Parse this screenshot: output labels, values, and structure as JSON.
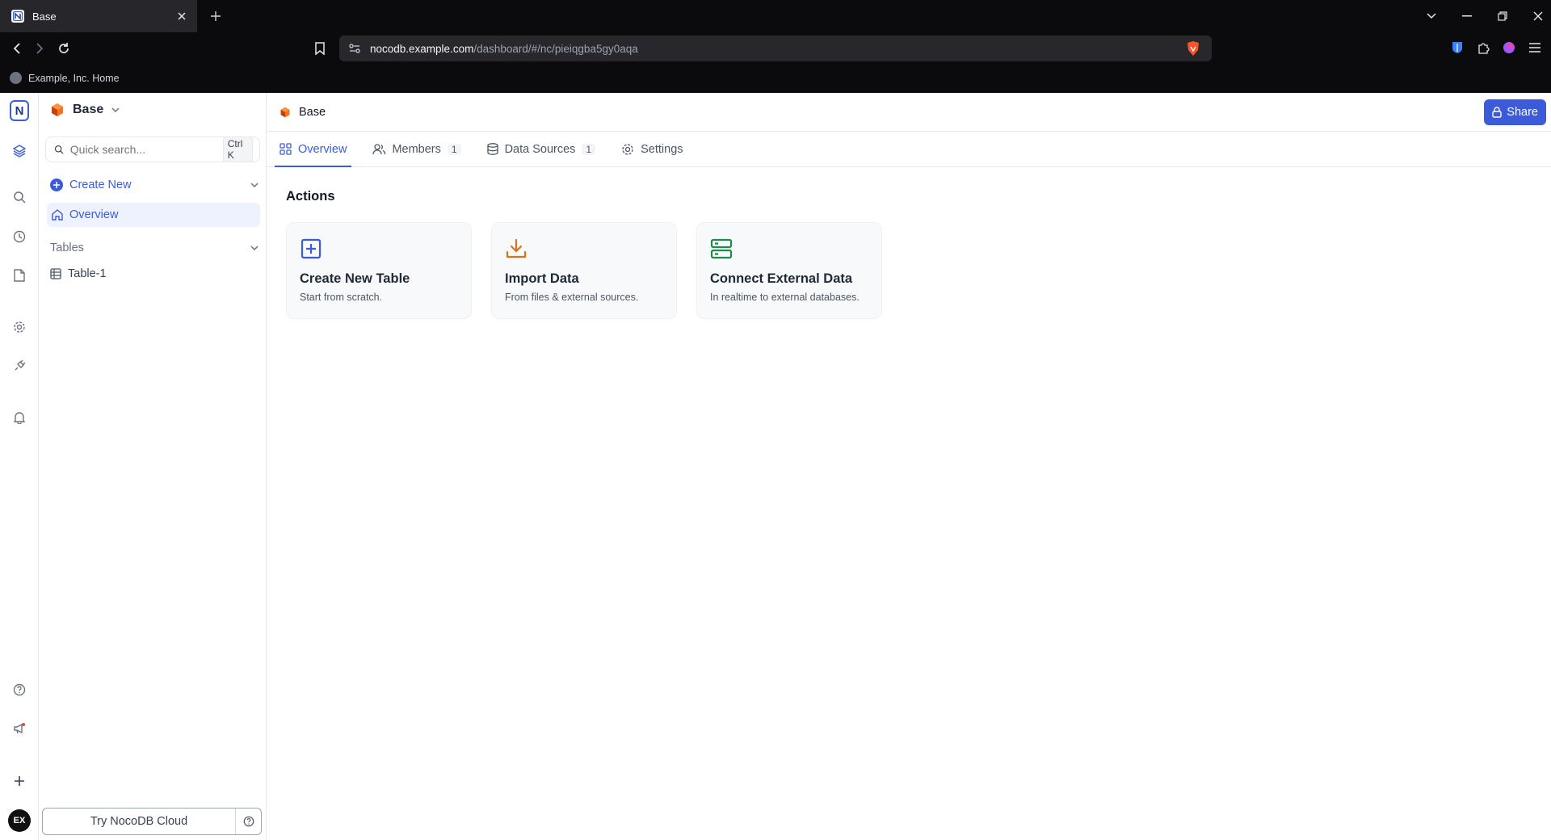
{
  "browser": {
    "tab_title": "Base",
    "url_host": "nocodb.example.com",
    "url_path": "/dashboard/#/nc/pieiqgba5gy0aqa",
    "bookmark": "Example, Inc. Home"
  },
  "sidebar": {
    "base_name": "Base",
    "search_placeholder": "Quick search...",
    "search_shortcut": "Ctrl K",
    "create_new": "Create New",
    "overview": "Overview",
    "tables_header": "Tables",
    "tables": [
      {
        "label": "Table-1"
      }
    ],
    "cloud_button": "Try NocoDB Cloud"
  },
  "rail": {
    "avatar_initials": "EX"
  },
  "topbar": {
    "title": "Base",
    "share": "Share"
  },
  "tabs": [
    {
      "label": "Overview",
      "count": null,
      "active": true
    },
    {
      "label": "Members",
      "count": "1",
      "active": false
    },
    {
      "label": "Data Sources",
      "count": "1",
      "active": false
    },
    {
      "label": "Settings",
      "count": null,
      "active": false
    }
  ],
  "actions": {
    "title": "Actions",
    "cards": [
      {
        "title": "Create New Table",
        "subtitle": "Start from scratch.",
        "icon": "plus-square-icon",
        "color": "#3b5bdb"
      },
      {
        "title": "Import Data",
        "subtitle": "From files & external sources.",
        "icon": "download-icon",
        "color": "#d9731a"
      },
      {
        "title": "Connect External Data",
        "subtitle": "In realtime to external databases.",
        "icon": "server-icon",
        "color": "#1e8a4c"
      }
    ]
  },
  "colors": {
    "accent": "#3b5bdb",
    "chrome_bg": "#0b0b0e"
  }
}
